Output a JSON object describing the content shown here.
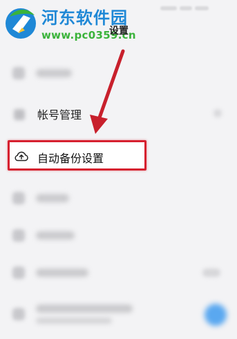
{
  "watermark": {
    "site_name": "河东软件园",
    "url": "www.pc0359.cn"
  },
  "header": {
    "title": "设置"
  },
  "settings": {
    "account_label": "帐号管理",
    "auto_backup_label": "自动备份设置"
  },
  "colors": {
    "highlight_border": "#d6202f",
    "arrow": "#c8202c",
    "watermark_blue": "#1f88d6",
    "watermark_green": "#3bb33b",
    "toggle_blue": "#5aa8f0"
  },
  "icons": {
    "auto_backup": "cloud-upload-icon",
    "watermark_logo": "site-logo-icon"
  }
}
